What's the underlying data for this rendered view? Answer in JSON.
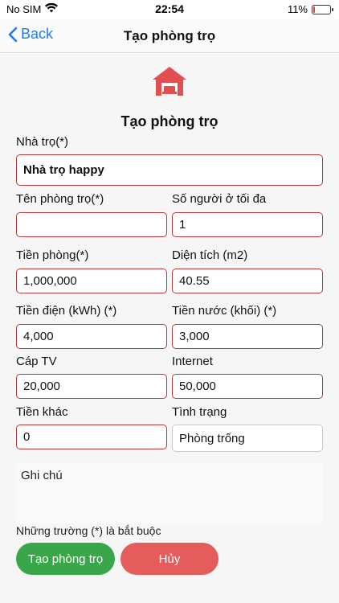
{
  "status": {
    "carrier": "No SIM",
    "time": "22:54",
    "battery": "11%",
    "battery_level": 0.11,
    "battery_color": "#e53935"
  },
  "nav": {
    "back_label": "Back",
    "title": "Tạo phòng trọ"
  },
  "form": {
    "title": "Tạo phòng trọ",
    "nha_tro": {
      "label": "Nhà trọ(*)",
      "value": "Nhà trọ happy"
    },
    "ten_phong": {
      "label": "Tên phòng trọ(*)",
      "value": ""
    },
    "so_nguoi": {
      "label": "Số người ở tối đa",
      "value": "1"
    },
    "tien_phong": {
      "label": "Tiền phòng(*)",
      "value": "1,000,000"
    },
    "dien_tich": {
      "label": "Diện tích (m2)",
      "value": "40.55"
    },
    "tien_dien": {
      "label": "Tiền điện (kWh) (*)",
      "value": "4,000"
    },
    "tien_nuoc": {
      "label": "Tiền nước (khối) (*)",
      "value": "3,000"
    },
    "cap_tv": {
      "label": "Cáp TV",
      "value": "20,000"
    },
    "internet": {
      "label": "Internet",
      "value": "50,000"
    },
    "tien_khac": {
      "label": "Tiền khác",
      "value": "0"
    },
    "tinh_trang": {
      "label": "Tình trạng",
      "value": "Phòng trống"
    },
    "ghi_chu": {
      "placeholder": "Ghi chú"
    },
    "required_note": "Những trường (*) là bắt buộc"
  },
  "buttons": {
    "create": "Tạo phòng trọ",
    "cancel": "Hủy"
  },
  "colors": {
    "accent": "#1e7cf2",
    "field_border": "#b33a3a",
    "create_bg": "#3aa64a",
    "cancel_bg": "#e45c5c",
    "icon": "#e05050"
  }
}
